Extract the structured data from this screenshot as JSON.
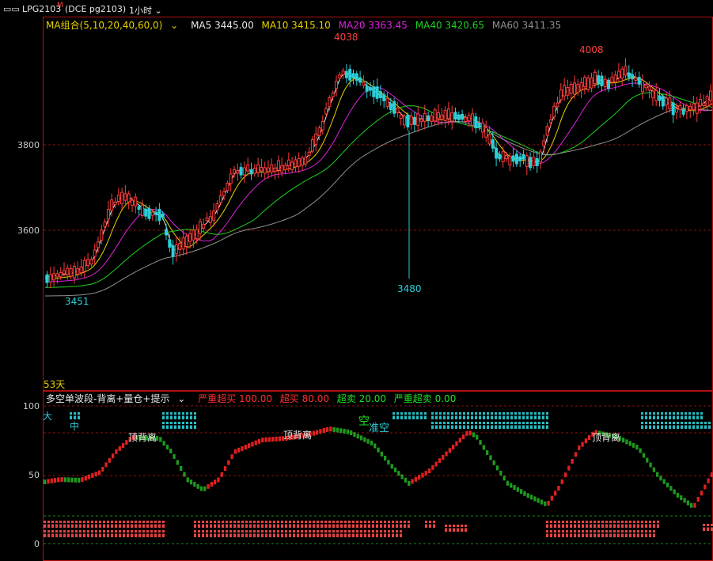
{
  "header": {
    "icon": "window-swap-icon",
    "symbol": "LPG2103",
    "badge": "M",
    "exchange_code": "(DCE pg2103)",
    "period": "1小时"
  },
  "main_chart": {
    "ma_group_label": "MA组合(5,10,20,40,60,0)",
    "ma": [
      {
        "label": "MA5 3445.00",
        "color": "#e8e8e8"
      },
      {
        "label": "MA10 3415.10",
        "color": "#e8d200"
      },
      {
        "label": "MA20 3363.45",
        "color": "#e020e0"
      },
      {
        "label": "MA40 3420.65",
        "color": "#20d020"
      },
      {
        "label": "MA60 3411.35",
        "color": "#909090"
      }
    ],
    "price_ticks": [
      "3800",
      "3600"
    ],
    "annotations": {
      "high_left": "4038",
      "high_right": "4008",
      "low_left": "3451",
      "low_mid": "3480"
    },
    "days_label": "53天"
  },
  "indicator": {
    "name": "多空单波段-背离+量仓+提示",
    "legend": [
      {
        "label": "严重超买 100.00",
        "color": "#ff3030"
      },
      {
        "label": "超买 80.00",
        "color": "#ff3030"
      },
      {
        "label": "超卖 20.00",
        "color": "#20e020"
      },
      {
        "label": "严重超卖 0.00",
        "color": "#20e020"
      }
    ],
    "ticks": [
      "100",
      "50",
      "0"
    ],
    "labels": {
      "top_div_1": "顶背离",
      "top_div_2": "顶背离",
      "top_div_3": "顶背离",
      "kong": "空",
      "zhun_kong": "准空",
      "da": "大",
      "zhong": "中"
    }
  },
  "colors": {
    "up": "#ff3b3b",
    "down": "#2ad0d8",
    "osc_up": "#e02020",
    "osc_down": "#1e9a1e",
    "grid": "#8b1010"
  }
}
